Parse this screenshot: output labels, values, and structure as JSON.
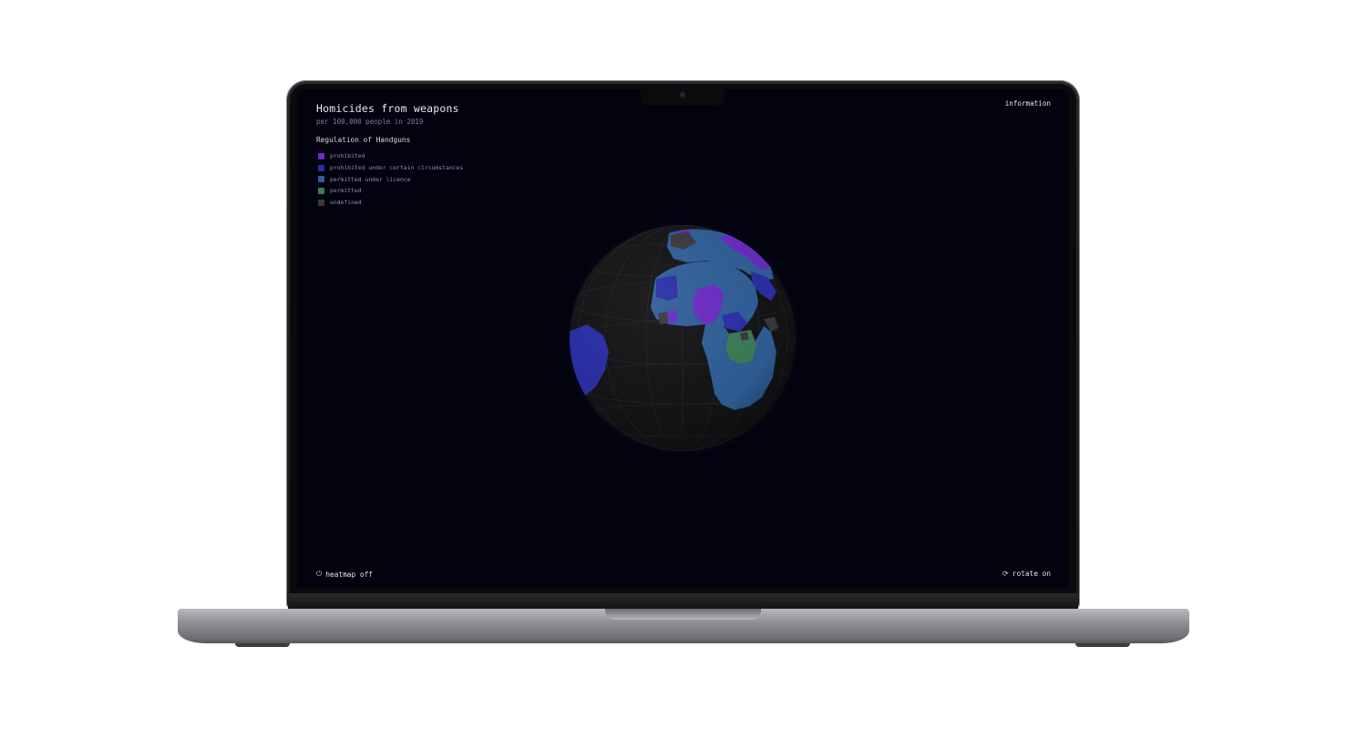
{
  "app": {
    "title": "Homicides from weapons",
    "subtitle": "per 100,000 people in 2019",
    "info_label": "information"
  },
  "legend": {
    "title": "Regulation of Handguns",
    "items": [
      {
        "label": "prohibited",
        "color": "#6a2bc4"
      },
      {
        "label": "prohibited under certain circumstances",
        "color": "#2a2fa8"
      },
      {
        "label": "permitted under licence",
        "color": "#2f5f98"
      },
      {
        "label": "permitted",
        "color": "#3c7c58"
      },
      {
        "label": "undefined",
        "color": "#3a3a3e"
      }
    ]
  },
  "controls": {
    "heatmap_label": "heatmap off",
    "heatmap_icon": "power-icon",
    "rotate_label": "rotate on",
    "rotate_icon": "rotate-icon"
  },
  "colors": {
    "background": "#03020f",
    "ocean": "#121214",
    "glow": "#3c6edc"
  }
}
